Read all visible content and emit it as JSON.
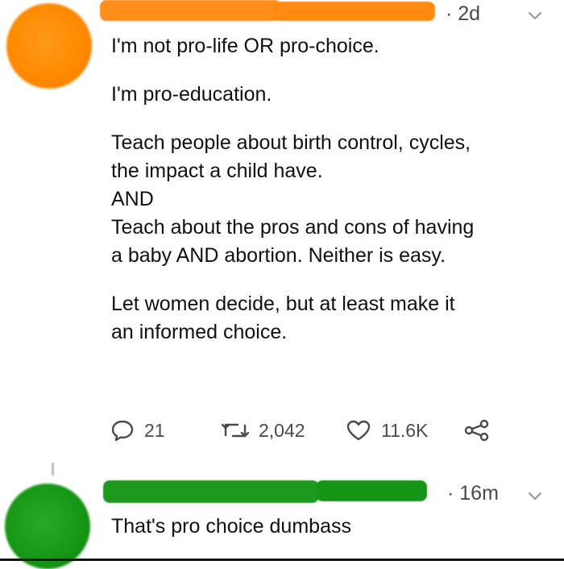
{
  "tweet": {
    "timestamp": "· 2d",
    "lines": [
      "I'm not pro-life OR pro-choice.",
      "",
      "I'm pro-education.",
      "",
      "Teach people about birth control, cycles,",
      "the impact a child have.",
      "AND",
      "Teach about the pros and cons of having",
      "a baby AND abortion. Neither is easy.",
      "",
      "Let women decide, but at least make it",
      "an informed choice."
    ],
    "actions": {
      "replies": "21",
      "retweets": "2,042",
      "likes": "11.6K"
    }
  },
  "reply": {
    "timestamp": "· 16m",
    "text": "That's pro choice dumbass"
  },
  "colors": {
    "orange_redaction": "#ff8a10",
    "green_redaction": "#169916",
    "text": "#111111",
    "muted": "#4a4a4a"
  },
  "icons": {
    "reply": "speech-bubble-icon",
    "retweet": "retweet-icon",
    "like": "heart-icon",
    "share": "share-icon",
    "menu": "chevron-down-icon"
  }
}
